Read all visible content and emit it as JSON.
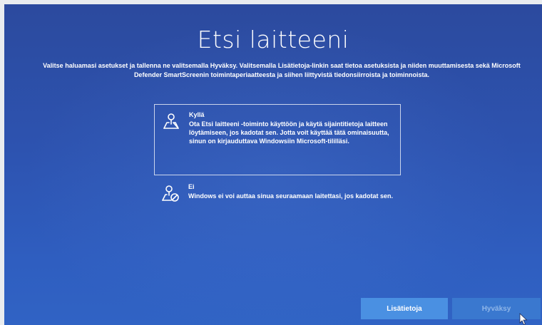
{
  "page": {
    "title": "Etsi laitteeni",
    "description": "Valitse haluamasi asetukset ja tallenna ne valitsemalla Hyväksy. Valitsemalla Lisätietoja-linkin saat tietoa asetuksista ja niiden muuttamisesta sekä Microsoft Defender SmartScreenin toimintaperiaatteesta ja siihen liittyvistä tiedonsiirroista ja toiminnoista."
  },
  "options": [
    {
      "title": "Kyllä",
      "body": "Ota Etsi laitteeni -toiminto käyttöön ja käytä sijaintitietoja laitteen löytämiseen, jos kadotat sen. Jotta voit käyttää tätä ominaisuutta, sinun on kirjauduttava Windowsiin Microsoft-tililläsi.",
      "icon": "location-pin-map-icon",
      "selected": true
    },
    {
      "title": "Ei",
      "body": "Windows ei voi auttaa sinua seuraamaan laitettasi, jos kadotat sen.",
      "icon": "location-off-icon",
      "selected": false
    }
  ],
  "buttons": {
    "more_info": "Lisätietoja",
    "accept": "Hyväksy"
  },
  "colors": {
    "background": "#2d53b0",
    "button_primary": "#4a90e2",
    "button_disabled": "#3a78cf",
    "text": "#ffffff"
  }
}
